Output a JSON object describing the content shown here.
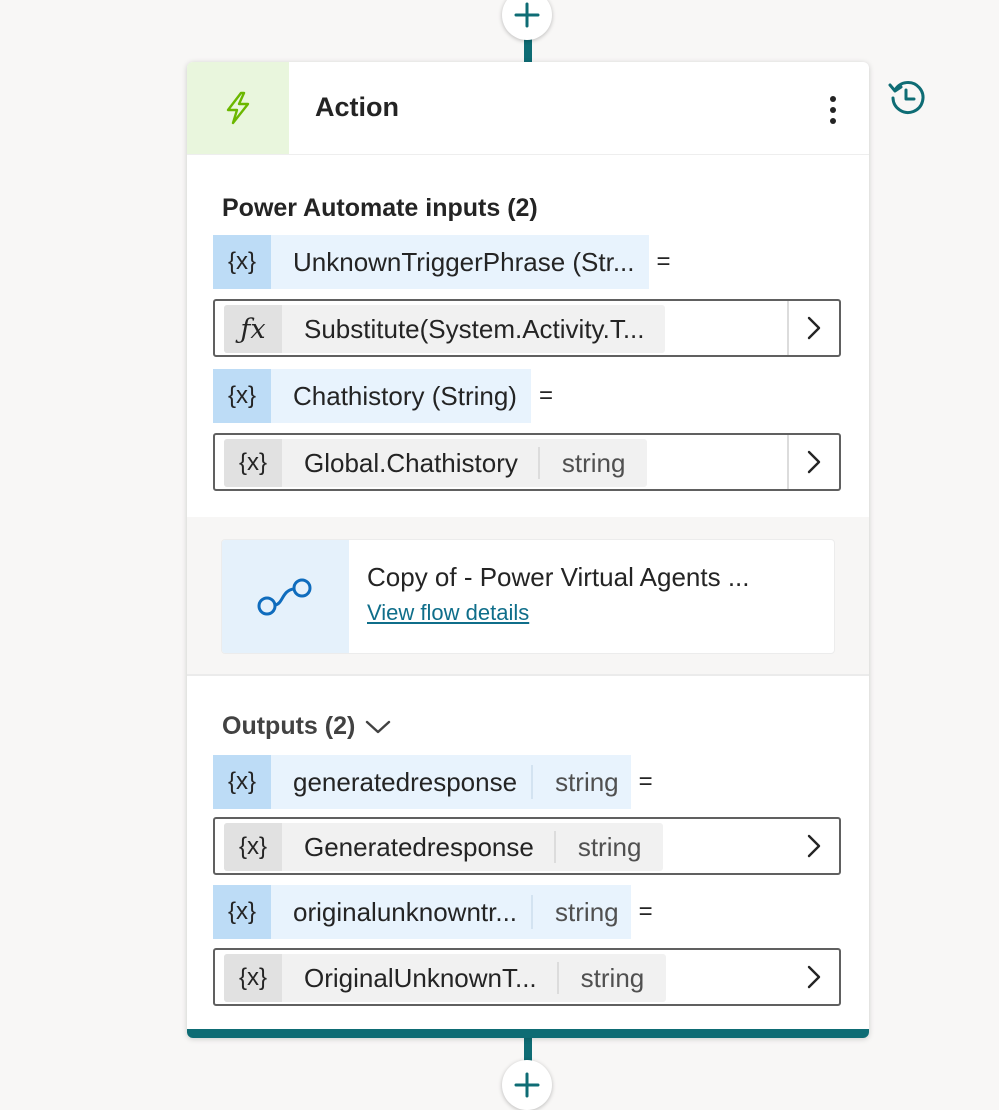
{
  "header": {
    "title": "Action",
    "more_icon": "more-vertical-icon",
    "action_icon": "lightning-bolt-icon"
  },
  "inputs": {
    "title": "Power Automate inputs (2)",
    "items": [
      {
        "name": "UnknownTriggerPhrase (Str...",
        "equals": "=",
        "value": "Substitute(System.Activity.T...",
        "value_icon": "fx-icon"
      },
      {
        "name": "Chathistory (String)",
        "equals": "=",
        "value": "Global.Chathistory",
        "value_type": "string",
        "value_icon": "variable-icon"
      }
    ]
  },
  "flow": {
    "name": "Copy of - Power Virtual Agents ...",
    "link": "View flow details",
    "icon": "flow-icon"
  },
  "outputs": {
    "title": "Outputs (2)",
    "items": [
      {
        "name": "generatedresponse",
        "type": "string",
        "equals": "=",
        "value": "Generatedresponse",
        "value_type": "string"
      },
      {
        "name": "originalunknowntr...",
        "type": "string",
        "equals": "=",
        "value": "OriginalUnknownT...",
        "value_type": "string"
      }
    ]
  },
  "variable_glyph": "{x}",
  "colors": {
    "accent": "#0e6c74",
    "action_icon": "#6bb700",
    "header_icon_bg": "#e9f6dd",
    "variable_bg": "#e8f3fd",
    "variable_icon_bg": "#bddcf6",
    "link": "#0f6e8a",
    "flow_icon": "#0f6cbd"
  }
}
